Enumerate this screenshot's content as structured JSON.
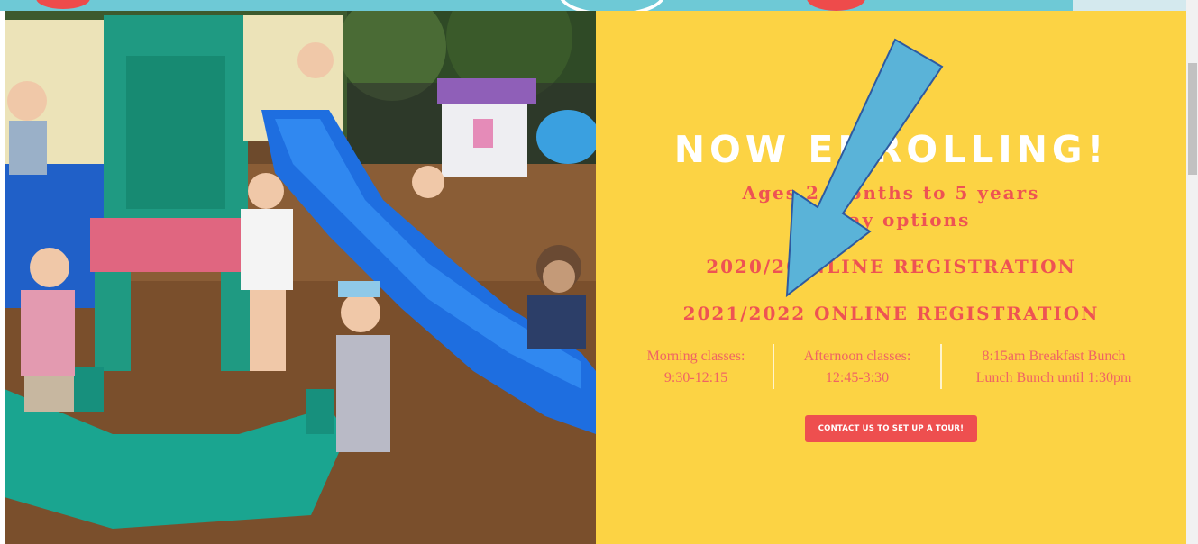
{
  "hero": {
    "headline": "NOW ENROLLING!",
    "ages": "Ages 2  months to 5 years",
    "days": "1  day options",
    "registration_links": [
      "2020/20  NLINE REGISTRATION",
      "2021/2022 ONLINE REGISTRATION"
    ],
    "schedule": [
      {
        "title": "Morning classes:",
        "detail": "9:30-12:15"
      },
      {
        "title": "Afternoon classes:",
        "detail": "12:45-3:30"
      },
      {
        "title": "8:15am Breakfast Bunch",
        "detail": "Lunch Bunch until 1:30pm"
      }
    ],
    "cta_label": "CONTACT US TO SET UP A TOUR!"
  },
  "colors": {
    "panel": "#fcd344",
    "accent": "#ee5353",
    "header": "#6ec9d6",
    "arrow": "#5ab3d8"
  },
  "annotation": {
    "icon": "down-left-arrow-icon"
  }
}
